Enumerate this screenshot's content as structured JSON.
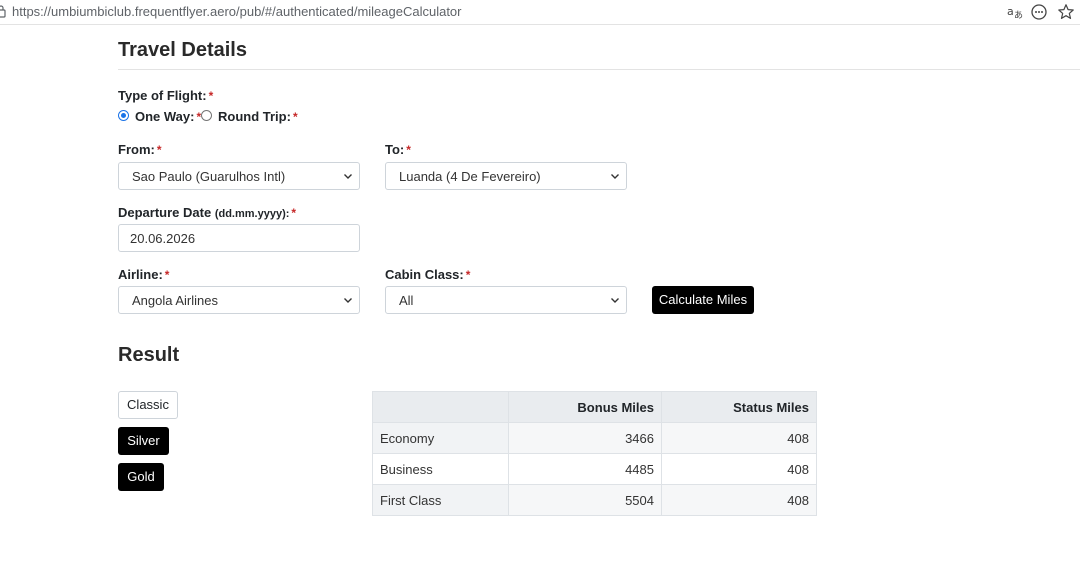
{
  "browser": {
    "url": "https://umbiumbiclub.frequentflyer.aero/pub/#/authenticated/mileageCalculator",
    "toolbar_icons": [
      "translate-icon",
      "more-icon",
      "favorite-star-icon"
    ]
  },
  "travel": {
    "title": "Travel Details",
    "flight_type": {
      "label": "Type of Flight:",
      "options": [
        {
          "label": "One Way:",
          "selected": true
        },
        {
          "label": "Round Trip:",
          "selected": false
        }
      ]
    },
    "from": {
      "label": "From:",
      "value": "Sao Paulo (Guarulhos Intl)"
    },
    "to": {
      "label": "To:",
      "value": "Luanda (4 De Fevereiro)"
    },
    "departure": {
      "label": "Departure Date",
      "format_hint": "(dd.mm.yyyy):",
      "value": "20.06.2026"
    },
    "airline": {
      "label": "Airline:",
      "value": "Angola Airlines"
    },
    "cabin": {
      "label": "Cabin Class:",
      "value": "All"
    },
    "calculate_label": "Calculate Miles",
    "required_mark": "*"
  },
  "result": {
    "title": "Result",
    "tiers": [
      {
        "label": "Classic",
        "active": false
      },
      {
        "label": "Silver",
        "active": true
      },
      {
        "label": "Gold",
        "active": true
      }
    ],
    "table": {
      "headers": [
        "",
        "Bonus Miles",
        "Status Miles"
      ],
      "rows": [
        {
          "cabin": "Economy",
          "bonus": "3466",
          "status": "408"
        },
        {
          "cabin": "Business",
          "bonus": "4485",
          "status": "408"
        },
        {
          "cabin": "First Class",
          "bonus": "5504",
          "status": "408"
        }
      ]
    }
  },
  "colors": {
    "required": "#c62828",
    "button_dark": "#000000",
    "radio_accent": "#1a73e8"
  }
}
